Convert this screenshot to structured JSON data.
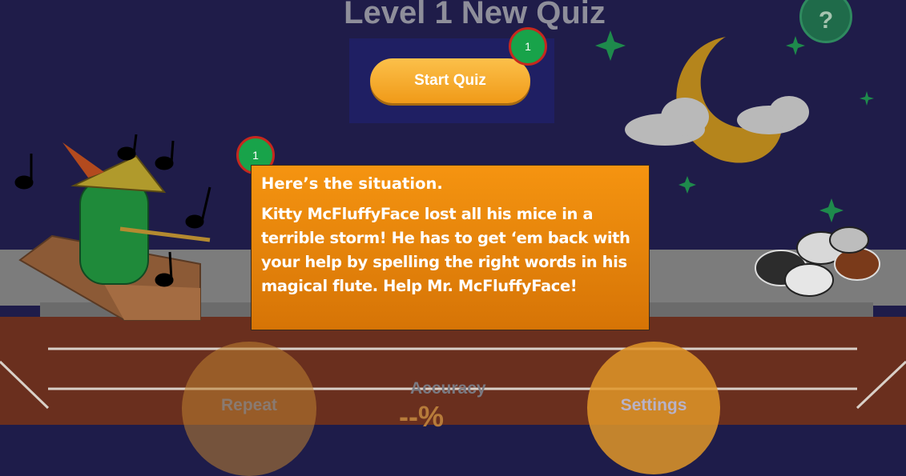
{
  "header": {
    "title": "Level 1 New Quiz"
  },
  "help": {
    "label": "?"
  },
  "start": {
    "label": "Start Quiz"
  },
  "badges": {
    "start_badge": "1",
    "dialog_badge": "1"
  },
  "dialog": {
    "heading": "Here’s the situation.",
    "body": "Kitty McFluffyFace lost all his mice in a terrible storm! He has to get ‘em back with your help by spelling the right words in his magical flute. Help Mr. McFluffyFace!"
  },
  "bottom": {
    "repeat_label": "Repeat",
    "settings_label": "Settings",
    "accuracy_label": "Accuracy",
    "accuracy_value": "--%"
  },
  "colors": {
    "accent": "#f59410",
    "sky": "#1f1c49",
    "badge": "#18a34a"
  }
}
